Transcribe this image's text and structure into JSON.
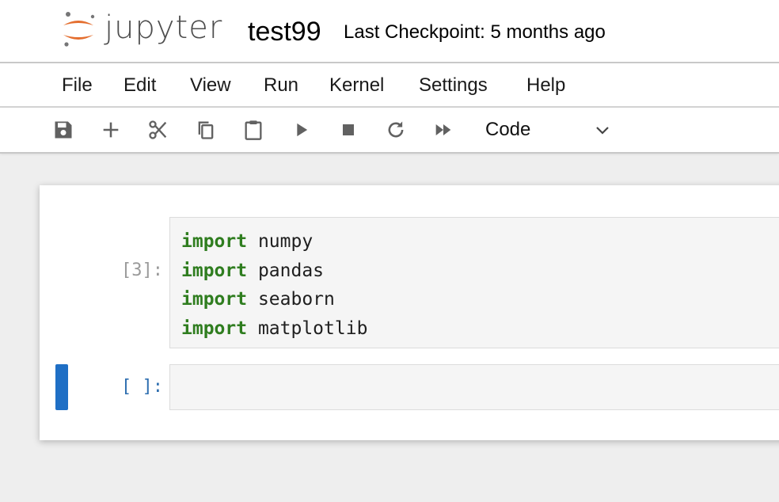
{
  "header": {
    "logo_text": "jupyter",
    "notebook_name": "test99",
    "checkpoint": "Last Checkpoint: 5 months ago"
  },
  "menu": {
    "items": [
      {
        "label": "File"
      },
      {
        "label": "Edit"
      },
      {
        "label": "View"
      },
      {
        "label": "Run"
      },
      {
        "label": "Kernel"
      },
      {
        "label": "Settings"
      },
      {
        "label": "Help"
      }
    ]
  },
  "toolbar": {
    "buttons": [
      "save-icon",
      "add-icon",
      "cut-icon",
      "copy-icon",
      "paste-icon",
      "run-icon",
      "stop-icon",
      "restart-icon",
      "run-all-icon"
    ],
    "cell_type": "Code"
  },
  "cells": [
    {
      "prompt": "[3]:",
      "lines": [
        {
          "keyword": "import",
          "rest": " numpy"
        },
        {
          "keyword": "import",
          "rest": " pandas"
        },
        {
          "keyword": "import",
          "rest": " seaborn"
        },
        {
          "keyword": "import",
          "rest": " matplotlib"
        }
      ]
    },
    {
      "prompt": "[ ]:",
      "lines": []
    }
  ],
  "colors": {
    "keyword": "#2f7d1f",
    "active_cell": "#1f6fc5",
    "logo_orange": "#e46e2e"
  }
}
